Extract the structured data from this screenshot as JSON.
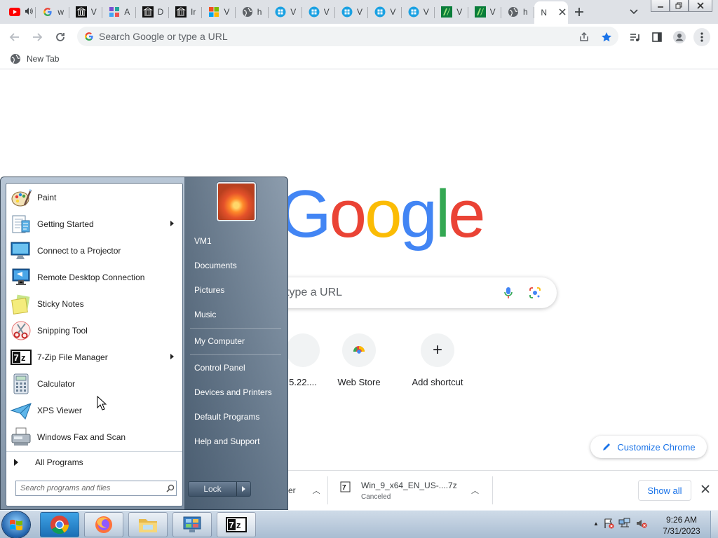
{
  "browser": {
    "tabs": [
      {
        "title": "",
        "icon": "youtube-icon"
      },
      {
        "title": "w",
        "icon": "google-icon"
      },
      {
        "title": "V",
        "icon": "museum-icon"
      },
      {
        "title": "A",
        "icon": "app-icon"
      },
      {
        "title": "D",
        "icon": "museum-icon"
      },
      {
        "title": "Ir",
        "icon": "museum-icon"
      },
      {
        "title": "V",
        "icon": "windows-icon"
      },
      {
        "title": "h",
        "icon": "globe-icon"
      },
      {
        "title": "V",
        "icon": "teal-app-icon"
      },
      {
        "title": "V",
        "icon": "teal-app-icon"
      },
      {
        "title": "V",
        "icon": "teal-app-icon"
      },
      {
        "title": "V",
        "icon": "teal-app-icon"
      },
      {
        "title": "V",
        "icon": "teal-app-icon"
      },
      {
        "title": "V",
        "icon": "green-app-icon"
      },
      {
        "title": "V",
        "icon": "green-app-icon"
      },
      {
        "title": "h",
        "icon": "globe-icon"
      },
      {
        "title": "N",
        "icon": "none",
        "active": true
      }
    ],
    "omnibox_placeholder": "Search Google or type a URL",
    "bookmark": "New Tab"
  },
  "ntp": {
    "logo": [
      "G",
      "o",
      "o",
      "g",
      "l",
      "e"
    ],
    "search_placeholder": "type a URL",
    "shortcuts": [
      {
        "label": "5.22...."
      },
      {
        "label": "Web Store"
      },
      {
        "label": "Add shortcut",
        "glyph": "+"
      }
    ],
    "customize": "Customize Chrome"
  },
  "downloads": {
    "items": [
      {
        "name": "er",
        "status": ""
      },
      {
        "name": "Win_9_x64_EN_US-....7z",
        "status": "Canceled"
      }
    ],
    "show_all": "Show all"
  },
  "start_menu": {
    "programs": [
      {
        "label": "Paint",
        "icon": "paint-icon",
        "submenu": false
      },
      {
        "label": "Getting Started",
        "icon": "getting-started-icon",
        "submenu": true
      },
      {
        "label": "Connect to a Projector",
        "icon": "projector-icon",
        "submenu": false
      },
      {
        "label": "Remote Desktop Connection",
        "icon": "remote-desktop-icon",
        "submenu": false
      },
      {
        "label": "Sticky Notes",
        "icon": "sticky-notes-icon",
        "submenu": false
      },
      {
        "label": "Snipping Tool",
        "icon": "scissors-icon",
        "submenu": false
      },
      {
        "label": "7-Zip File Manager",
        "icon": "seven-zip-icon",
        "submenu": true
      },
      {
        "label": "Calculator",
        "icon": "calculator-icon",
        "submenu": false
      },
      {
        "label": "XPS Viewer",
        "icon": "xps-viewer-icon",
        "submenu": false
      },
      {
        "label": "Windows Fax and Scan",
        "icon": "fax-icon",
        "submenu": false
      }
    ],
    "all_programs": "All Programs",
    "search_placeholder": "Search programs and files",
    "right_items": [
      "VM1",
      "Documents",
      "Pictures",
      "Music",
      "My Computer",
      "Control Panel",
      "Devices and Printers",
      "Default Programs",
      "Help and Support"
    ],
    "lock": "Lock",
    "seven_zip_glyph": "7z"
  },
  "taskbar": {
    "buttons": [
      "chrome-icon",
      "firefox-icon",
      "explorer-icon",
      "control-panel-icon",
      "seven-zip-icon"
    ],
    "time": "9:26 AM",
    "date": "7/31/2023"
  }
}
